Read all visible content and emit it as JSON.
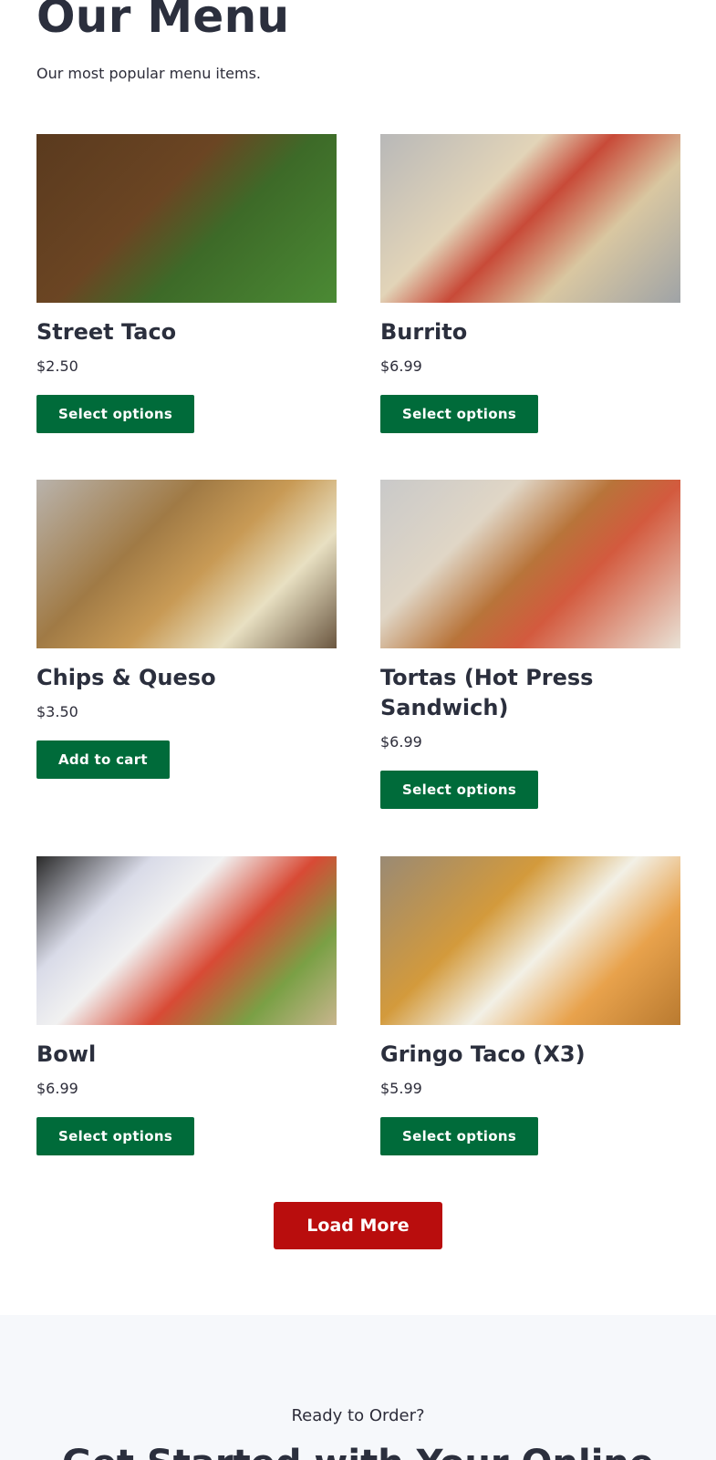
{
  "header": {
    "title": "Our Menu",
    "subtitle": "Our most popular menu items."
  },
  "items": [
    {
      "name": "Street Taco",
      "price": "$2.50",
      "button": "Select options",
      "image": "street-taco-photo"
    },
    {
      "name": "Burrito",
      "price": "$6.99",
      "button": "Select options",
      "image": "burrito-photo"
    },
    {
      "name": "Chips & Queso",
      "price": "$3.50",
      "button": "Add to cart",
      "image": "chips-queso-photo"
    },
    {
      "name": "Tortas (Hot Press Sandwich)",
      "price": "$6.99",
      "button": "Select options",
      "image": "torta-photo"
    },
    {
      "name": "Bowl",
      "price": "$6.99",
      "button": "Select options",
      "image": "bowl-photo"
    },
    {
      "name": "Gringo Taco (X3)",
      "price": "$5.99",
      "button": "Select options",
      "image": "gringo-taco-photo"
    }
  ],
  "load_more": "Load More",
  "cta": {
    "eyebrow": "Ready to Order?",
    "heading": "Get Started with Your Online"
  },
  "colors": {
    "button_green": "#006b3a",
    "load_more_red": "#b90d0d",
    "cta_background": "#f6f8fb",
    "heading_text": "#2b2f3d"
  }
}
